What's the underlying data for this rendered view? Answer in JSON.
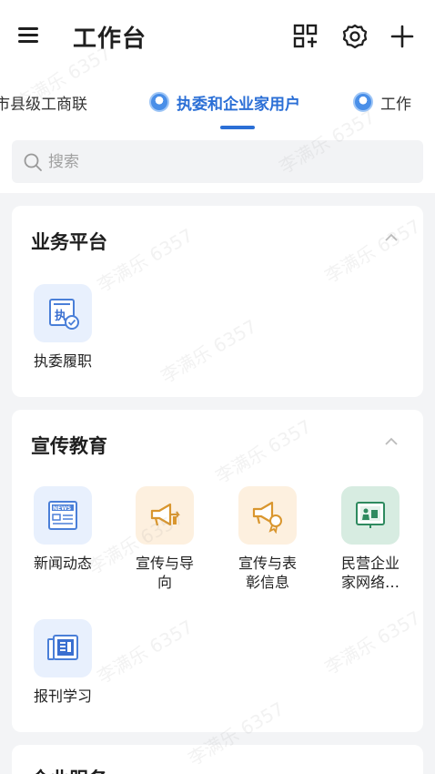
{
  "header": {
    "title": "工作台",
    "menu_icon": "hamburger-menu-icon",
    "qr_icon": "qr-scan-icon",
    "settings_icon": "gear-icon",
    "add_icon": "plus-icon"
  },
  "tabs": [
    {
      "label": "市县级工商联",
      "active": false
    },
    {
      "label": "执委和企业家用户",
      "active": true
    },
    {
      "label": "工作",
      "active": false
    }
  ],
  "search": {
    "placeholder": "搜索"
  },
  "sections": [
    {
      "title": "业务平台",
      "items": [
        {
          "label": "执委履职",
          "icon": "executive-duty-icon"
        }
      ]
    },
    {
      "title": "宣传教育",
      "items": [
        {
          "label": "新闻动态",
          "icon": "news-icon"
        },
        {
          "label": "宣传与导\n向",
          "icon": "megaphone-icon"
        },
        {
          "label": "宣传与表\n彰信息",
          "icon": "megaphone-award-icon"
        },
        {
          "label": "民营企业\n家网络…",
          "icon": "online-classroom-icon"
        },
        {
          "label": "报刊学习",
          "icon": "newspaper-icon"
        }
      ]
    },
    {
      "title": "企业服务",
      "items": []
    }
  ],
  "watermark": "李满乐 6357",
  "colors": {
    "accent": "#2b6fd6",
    "background": "#f3f4f6",
    "card": "#ffffff"
  }
}
